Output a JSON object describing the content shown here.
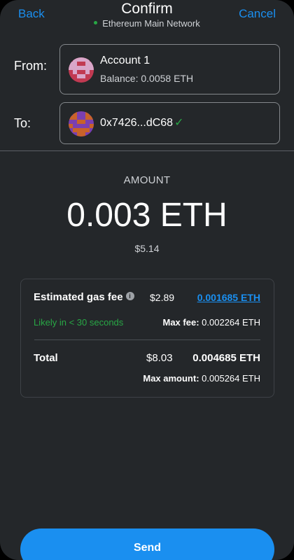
{
  "header": {
    "back_label": "Back",
    "title": "Confirm",
    "network": "Ethereum Main Network",
    "cancel_label": "Cancel"
  },
  "from": {
    "label": "From:",
    "account_name": "Account 1",
    "balance": "Balance: 0.0058 ETH"
  },
  "to": {
    "label": "To:",
    "address": "0x7426...dC68"
  },
  "amount": {
    "label": "AMOUNT",
    "value": "0.003 ETH",
    "fiat": "$5.14"
  },
  "gas": {
    "label": "Estimated gas fee",
    "fiat": "$2.89",
    "eth": "0.001685 ETH",
    "likely": "Likely in < 30 seconds",
    "max_fee_label": "Max fee:",
    "max_fee_value": "0.002264 ETH"
  },
  "total": {
    "label": "Total",
    "fiat": "$8.03",
    "eth": "0.004685 ETH",
    "max_amount_label": "Max amount:",
    "max_amount_value": "0.005264 ETH"
  },
  "send_label": "Send",
  "icons": {
    "network_dot": "green-dot-icon",
    "verified": "checkmark-icon",
    "info": "info-icon"
  },
  "colors": {
    "accent": "#1a8ff0",
    "success": "#28a745",
    "background": "#24272a"
  }
}
